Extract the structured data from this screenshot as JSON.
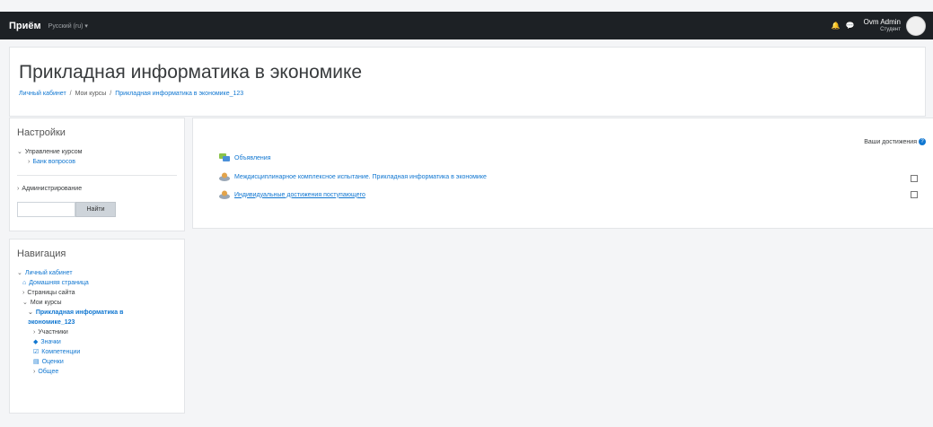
{
  "topbar": {
    "brand": "Приём",
    "language": "Русский (ru) ▾",
    "user_name": "Ovm Admin",
    "user_role": "Студент",
    "bell_glyph": "🔔",
    "chat_glyph": "💬"
  },
  "header": {
    "title": "Прикладная информатика в экономике",
    "breadcrumb": [
      "Личный кабинет",
      "Мои курсы",
      "Прикладная информатика в экономике_123"
    ]
  },
  "settings": {
    "title": "Настройки",
    "course_admin": "Управление курсом",
    "question_bank": "Банк вопросов",
    "administration": "Администрирование",
    "search_placeholder": "",
    "search_button": "Найти"
  },
  "navigation": {
    "title": "Навигация",
    "dashboard": "Личный кабинет",
    "home": "Домашняя страница",
    "site_pages": "Страницы сайта",
    "my_courses": "Мои курсы",
    "current_course": "Прикладная информатика в экономике_123",
    "participants": "Участники",
    "badges": "Значки",
    "competencies": "Компетенции",
    "grades": "Оценки",
    "general": "Общее"
  },
  "main": {
    "achievements_label": "Ваши достижения",
    "activities": [
      {
        "label": "Объявления",
        "icon": "forum-icon"
      },
      {
        "label": "Междисциплинарное комплексное испытание. Прикладная информатика в экономике",
        "icon": "quiz-icon"
      },
      {
        "label": "Индивидуальные достижения поступающего",
        "icon": "quiz-icon"
      }
    ]
  },
  "colors": {
    "topbar": "#1d2125",
    "link": "#1177d1",
    "background": "#f4f5f7"
  }
}
